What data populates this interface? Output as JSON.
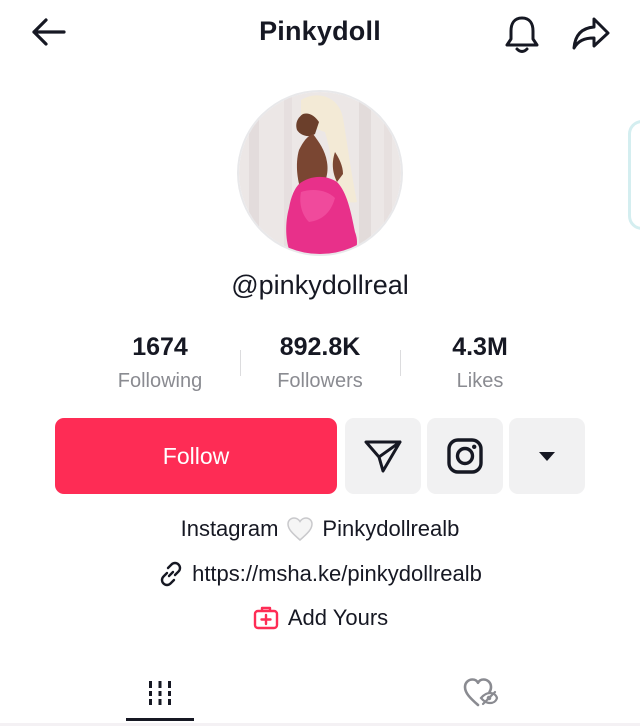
{
  "header": {
    "title": "Pinkydoll",
    "back_icon": "arrow-left-icon",
    "bell_icon": "bell-icon",
    "share_icon": "share-forward-icon"
  },
  "profile": {
    "avatar": "profile-photo",
    "handle": "@pinkydollreal"
  },
  "stats": [
    {
      "value": "1674",
      "label": "Following"
    },
    {
      "value": "892.8K",
      "label": "Followers"
    },
    {
      "value": "4.3M",
      "label": "Likes"
    }
  ],
  "actions": {
    "follow_label": "Follow",
    "message_icon": "send-message-icon",
    "instagram_icon": "instagram-icon",
    "more_icon": "caret-down-icon"
  },
  "bio": {
    "line1_prefix": "Instagram",
    "line1_emoji": "white-heart-icon",
    "line1_suffix": "Pinkydollrealb",
    "link_icon": "link-icon",
    "link": "https://msha.ke/pinkydollrealb",
    "add_yours_icon": "add-yours-icon",
    "add_yours": "Add Yours"
  },
  "tabs": [
    {
      "icon": "grid-videos-icon",
      "active": true
    },
    {
      "icon": "liked-hidden-icon",
      "active": false
    }
  ],
  "colors": {
    "accent": "#fe2c55",
    "text": "#161823",
    "muted": "#8a8b91",
    "button_bg": "#f1f1f2"
  }
}
